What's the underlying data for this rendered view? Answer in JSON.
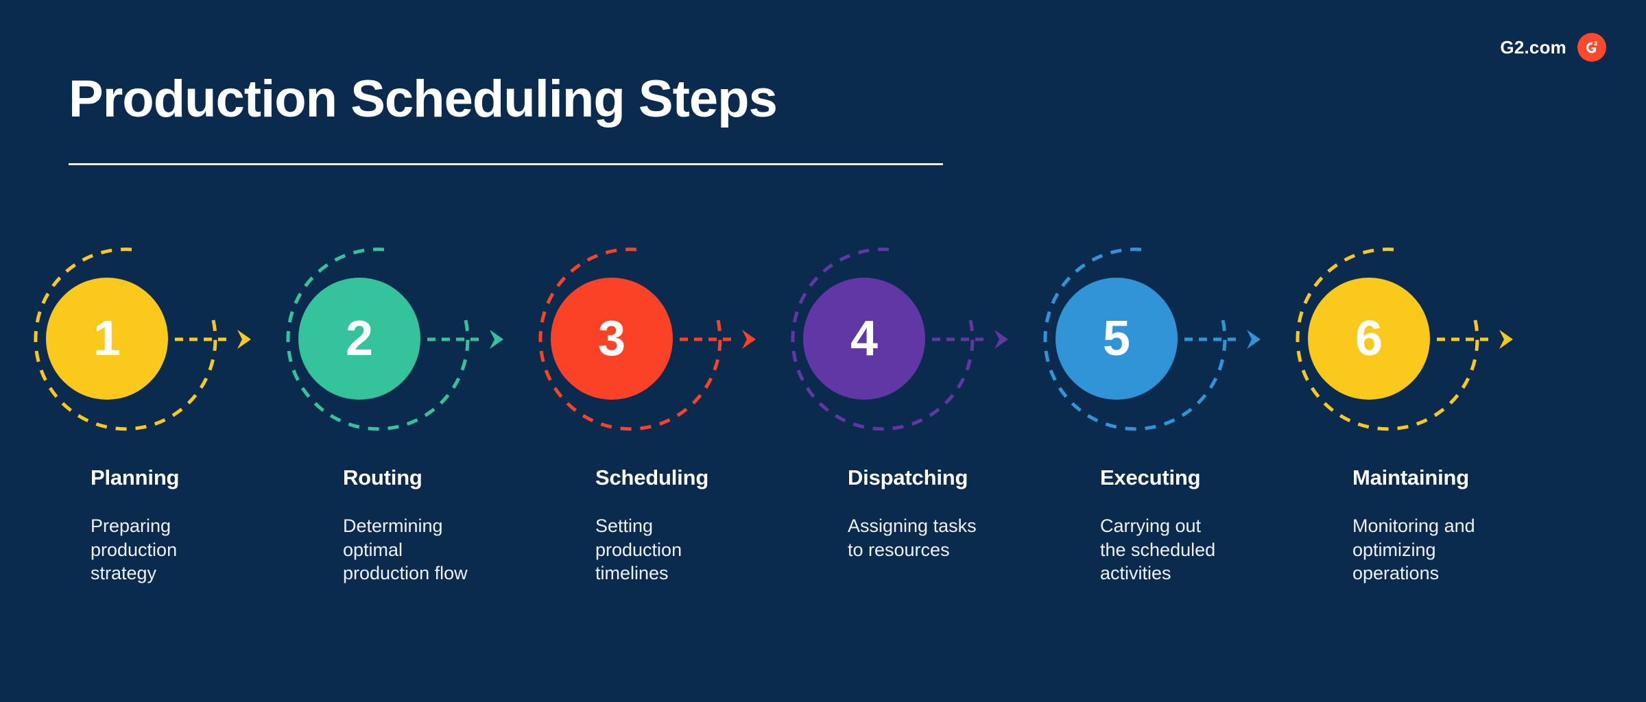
{
  "brand": {
    "name": "G2.com",
    "badge_icon": "g2-logo-icon",
    "badge_letter": "G",
    "badge_superscript": "2",
    "badge_color": "#ff492c"
  },
  "header": {
    "title": "Production Scheduling Steps"
  },
  "theme": {
    "background": "#0a2a4e",
    "text": "#ffffff",
    "rule": "#e8edf3"
  },
  "steps": [
    {
      "number": "1",
      "title": "Planning",
      "description": "Preparing\nproduction\nstrategy",
      "color": "#fbc91b"
    },
    {
      "number": "2",
      "title": "Routing",
      "description": "Determining\noptimal\nproduction flow",
      "color": "#35c39b"
    },
    {
      "number": "3",
      "title": "Scheduling",
      "description": "Setting\nproduction\ntimelines",
      "color": "#fb4226"
    },
    {
      "number": "4",
      "title": "Dispatching",
      "description": "Assigning tasks\nto resources",
      "color": "#6136a5"
    },
    {
      "number": "5",
      "title": "Executing",
      "description": "Carrying out\nthe scheduled\nactivities",
      "color": "#3194d6"
    },
    {
      "number": "6",
      "title": "Maintaining",
      "description": "Monitoring and\noptimizing\noperations",
      "color": "#fbc91b"
    }
  ]
}
